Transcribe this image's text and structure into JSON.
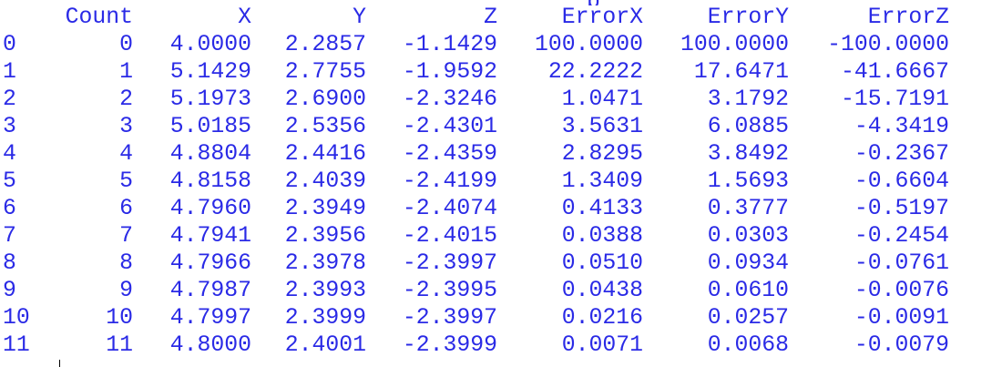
{
  "console": {
    "headers": [
      "Count",
      "X",
      "Y",
      "Z",
      "ErrorX",
      "ErrorY",
      "ErrorZ"
    ],
    "rows": [
      {
        "index": "0",
        "cells": [
          "0",
          "4.0000",
          "2.2857",
          "-1.1429",
          "100.0000",
          "100.0000",
          "-100.0000"
        ]
      },
      {
        "index": "1",
        "cells": [
          "1",
          "5.1429",
          "2.7755",
          "-1.9592",
          "22.2222",
          "17.6471",
          "-41.6667"
        ]
      },
      {
        "index": "2",
        "cells": [
          "2",
          "5.1973",
          "2.6900",
          "-2.3246",
          "1.0471",
          "3.1792",
          "-15.7191"
        ]
      },
      {
        "index": "3",
        "cells": [
          "3",
          "5.0185",
          "2.5356",
          "-2.4301",
          "3.5631",
          "6.0885",
          "-4.3419"
        ]
      },
      {
        "index": "4",
        "cells": [
          "4",
          "4.8804",
          "2.4416",
          "-2.4359",
          "2.8295",
          "3.8492",
          "-0.2367"
        ]
      },
      {
        "index": "5",
        "cells": [
          "5",
          "4.8158",
          "2.4039",
          "-2.4199",
          "1.3409",
          "1.5693",
          "-0.6604"
        ]
      },
      {
        "index": "6",
        "cells": [
          "6",
          "4.7960",
          "2.3949",
          "-2.4074",
          "0.4133",
          "0.3777",
          "-0.5197"
        ]
      },
      {
        "index": "7",
        "cells": [
          "7",
          "4.7941",
          "2.3956",
          "-2.4015",
          "0.0388",
          "0.0303",
          "-0.2454"
        ]
      },
      {
        "index": "8",
        "cells": [
          "8",
          "4.7966",
          "2.3978",
          "-2.3997",
          "0.0510",
          "0.0934",
          "-0.0761"
        ]
      },
      {
        "index": "9",
        "cells": [
          "9",
          "4.7987",
          "2.3993",
          "-2.3995",
          "0.0438",
          "0.0610",
          "-0.0076"
        ]
      },
      {
        "index": "10",
        "cells": [
          "10",
          "4.7997",
          "2.3999",
          "-2.3997",
          "0.0216",
          "0.0257",
          "-0.0091"
        ]
      },
      {
        "index": "11",
        "cells": [
          "11",
          "4.8000",
          "2.4001",
          "-2.3999",
          "0.0071",
          "0.0068",
          "-0.0079"
        ]
      }
    ]
  },
  "colors": {
    "text": "#2a2ae6",
    "background": "#ffffff"
  }
}
